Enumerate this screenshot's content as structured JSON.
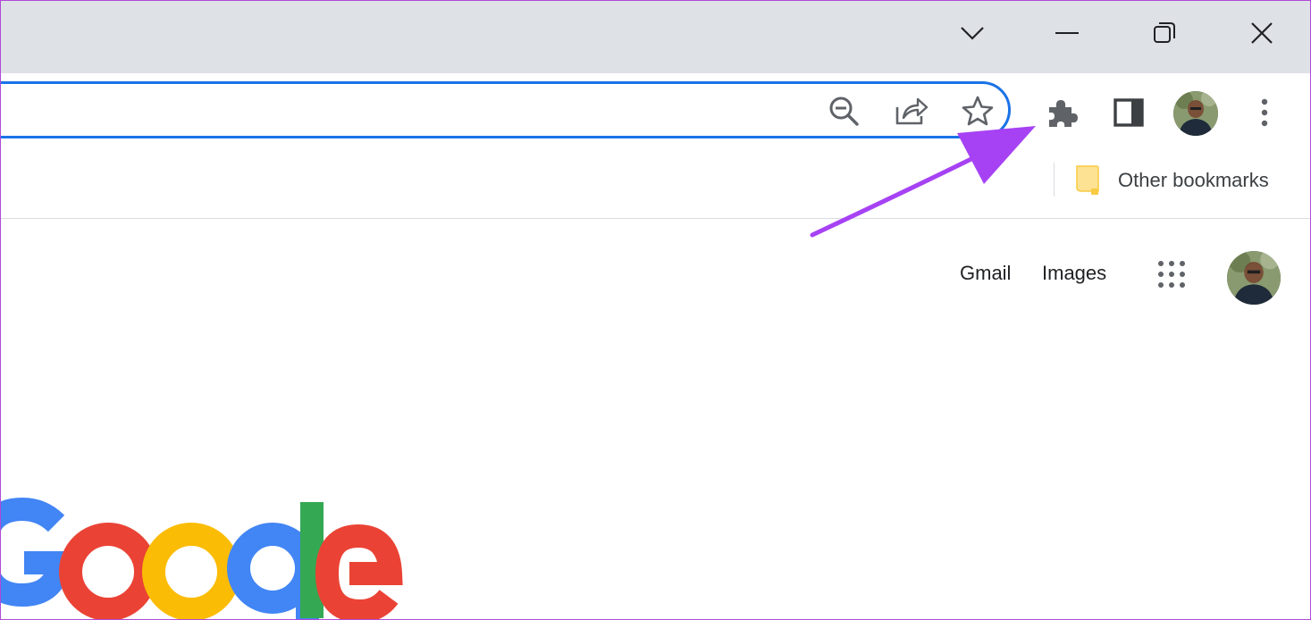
{
  "window_controls": {
    "tab_search": "chevron-down-icon",
    "minimize": "minimize-icon",
    "restore": "restore-icon",
    "close": "close-icon"
  },
  "omnibox": {
    "icons": [
      "zoom-out-icon",
      "share-icon",
      "bookmark-star-icon"
    ]
  },
  "toolbar": {
    "icons": [
      "extensions-puzzle-icon",
      "side-panel-icon",
      "profile-avatar",
      "more-menu-icon"
    ]
  },
  "bookmarks_bar": {
    "other_bookmarks_label": "Other bookmarks",
    "folder_icon": "folder-icon"
  },
  "google_page": {
    "gmail_label": "Gmail",
    "images_label": "Images",
    "apps_icon": "apps-grid-icon",
    "logo_text": "Google",
    "logo_colors": {
      "blue": "#4285f4",
      "red": "#ea4335",
      "yellow": "#fbbc05",
      "green": "#34a853"
    }
  },
  "annotation": {
    "arrow_color": "#a642f4",
    "points_to": "extensions-puzzle-icon"
  },
  "colors": {
    "accent": "#1a73e8",
    "titlebar": "#dee1e6",
    "icon": "#5f6368"
  }
}
